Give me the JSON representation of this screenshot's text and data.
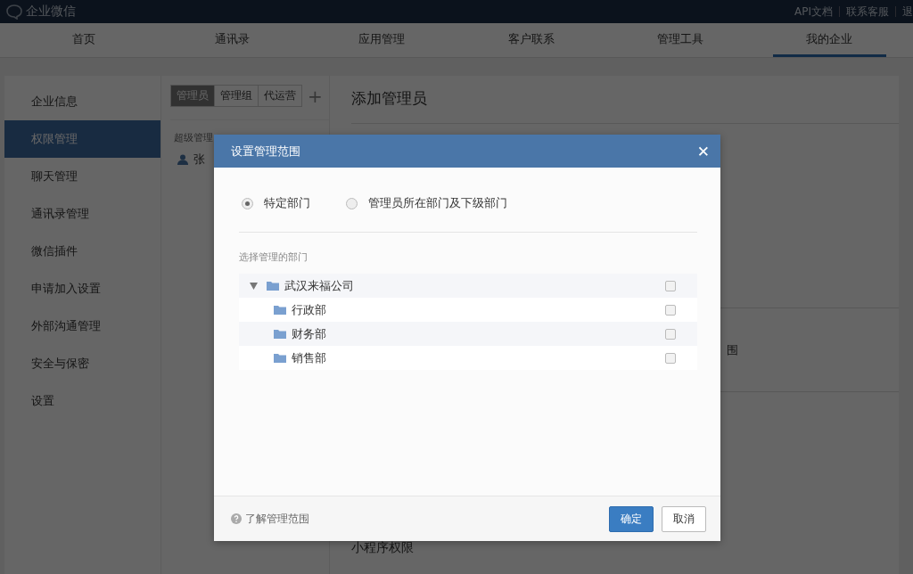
{
  "header": {
    "logo": "企业微信",
    "links": [
      "API文档",
      "联系客服",
      "退"
    ]
  },
  "nav": [
    {
      "label": "首页",
      "selected": false
    },
    {
      "label": "通讯录",
      "selected": false
    },
    {
      "label": "应用管理",
      "selected": false
    },
    {
      "label": "客户联系",
      "selected": false
    },
    {
      "label": "管理工具",
      "selected": false
    },
    {
      "label": "我的企业",
      "selected": true
    }
  ],
  "sidebar": [
    {
      "label": "企业信息",
      "selected": false
    },
    {
      "label": "权限管理",
      "selected": true
    },
    {
      "label": "聊天管理",
      "selected": false
    },
    {
      "label": "通讯录管理",
      "selected": false
    },
    {
      "label": "微信插件",
      "selected": false
    },
    {
      "label": "申请加入设置",
      "selected": false
    },
    {
      "label": "外部沟通管理",
      "selected": false
    },
    {
      "label": "安全与保密",
      "selected": false
    },
    {
      "label": "设置",
      "selected": false
    }
  ],
  "admin_tabs": [
    {
      "label": "管理员",
      "selected": true
    },
    {
      "label": "管理组",
      "selected": false
    },
    {
      "label": "代运营",
      "selected": false
    }
  ],
  "add_tab": "+",
  "admin_list": {
    "group": "超级管理",
    "member": "张"
  },
  "panel": {
    "title": "添加管理员",
    "partial_text": "围",
    "bottom_label": "小程序权限"
  },
  "dialog": {
    "title": "设置管理范围",
    "close": "✕",
    "scope_options": [
      {
        "label": "特定部门",
        "selected": true
      },
      {
        "label": "管理员所在部门及下级部门",
        "selected": false
      }
    ],
    "section_label": "选择管理的部门",
    "tree": [
      {
        "label": "武汉来福公司",
        "checked": false,
        "expanded": true,
        "children": [
          {
            "label": "行政部",
            "checked": false
          },
          {
            "label": "财务部",
            "checked": false
          },
          {
            "label": "销售部",
            "checked": false
          }
        ]
      }
    ],
    "help_link": "了解管理范围",
    "ok": "确定",
    "cancel": "取消"
  }
}
